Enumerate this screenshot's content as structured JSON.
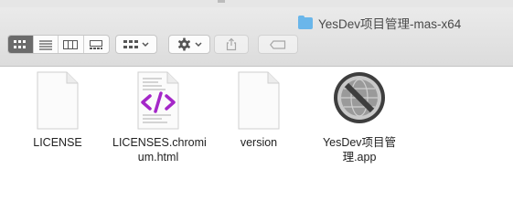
{
  "window": {
    "title": "YesDev项目管理-mas-x64"
  },
  "toolbar": {
    "view_modes": [
      "icon-view",
      "list-view",
      "column-view",
      "gallery-view"
    ],
    "active_view": "icon-view",
    "group_button": "group-by-icon",
    "action_button": "gear-icon",
    "share_button": "share-icon",
    "tag_button": "tag-icon"
  },
  "files": [
    {
      "name": "LICENSE",
      "kind": "document"
    },
    {
      "name": "LICENSES.chromium.html",
      "line1": "LICENSES.chromi",
      "line2": "um.html",
      "kind": "html"
    },
    {
      "name": "version",
      "kind": "document"
    },
    {
      "name": "YesDev项目管理.app",
      "line1": "YesDev项目管",
      "line2": "理.app",
      "kind": "application"
    }
  ]
}
